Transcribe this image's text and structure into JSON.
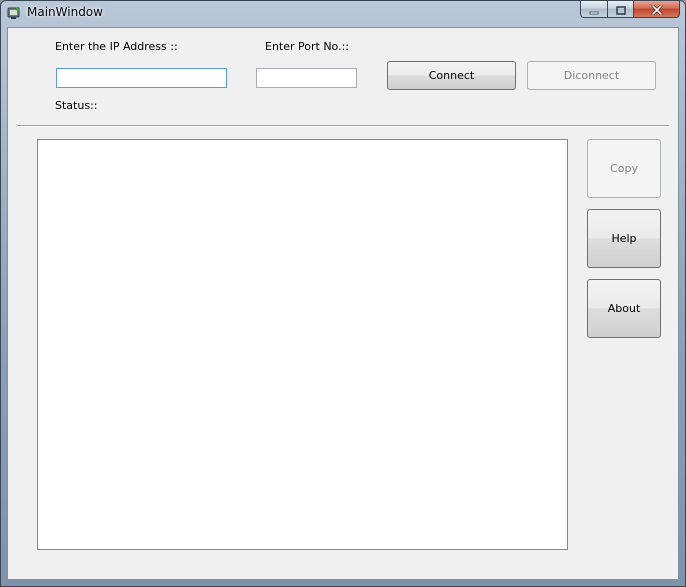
{
  "window": {
    "title": "MainWindow"
  },
  "form": {
    "ip_label": "Enter the IP Address ::",
    "ip_value": "",
    "port_label": "Enter Port No.::",
    "port_value": "",
    "status_label": "Status::"
  },
  "buttons": {
    "connect": "Connect",
    "disconnect": "Diconnect",
    "copy": "Copy",
    "help": "Help",
    "about": "About"
  },
  "output": {
    "text": ""
  },
  "icons": {
    "app": "app-icon",
    "minimize": "minimize-icon",
    "maximize": "maximize-icon",
    "close": "close-icon"
  },
  "colors": {
    "client_background": "#f0f0f0",
    "close_button": "#c0462b",
    "focus_border": "#569de5"
  }
}
